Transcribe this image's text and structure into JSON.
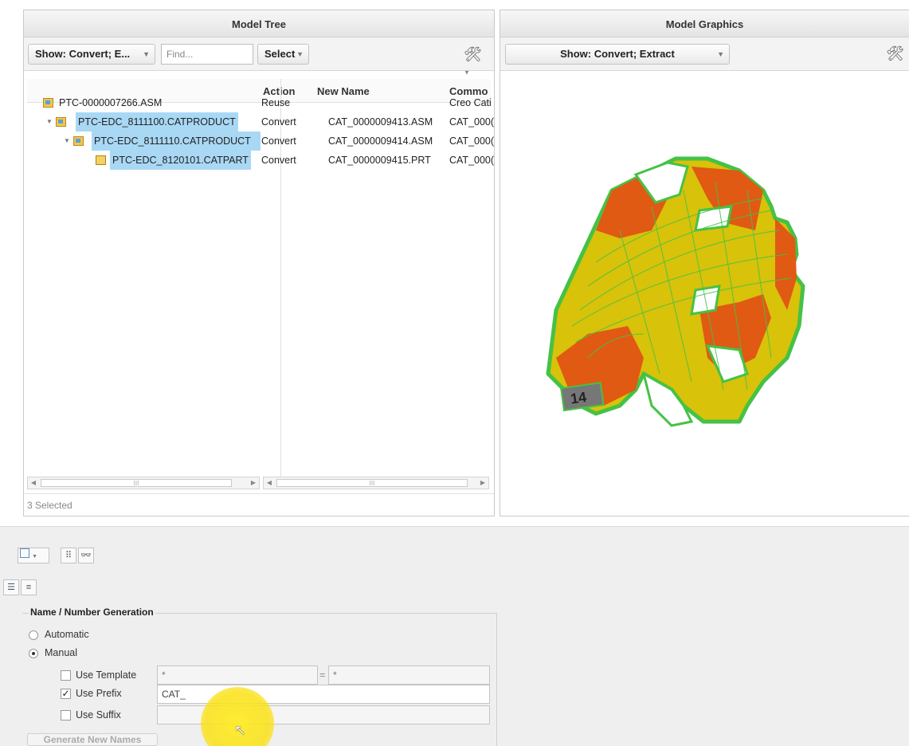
{
  "model_tree": {
    "title": "Model Tree",
    "show_filter": "Show: Convert; E...",
    "find_placeholder": "Find...",
    "select_label": "Select",
    "columns": [
      "Action",
      "New Name",
      "Commo"
    ],
    "rows": [
      {
        "name": "PTC-0000007266.ASM",
        "action": "Reuse",
        "new_name": "",
        "common": "Creo Cati"
      },
      {
        "name": "PTC-EDC_8111100.CATPRODUCT",
        "action": "Convert",
        "new_name": "CAT_0000009413.ASM",
        "common": "CAT_000("
      },
      {
        "name": "PTC-EDC_8111110.CATPRODUCT",
        "action": "Convert",
        "new_name": "CAT_0000009414.ASM",
        "common": "CAT_000("
      },
      {
        "name": "PTC-EDC_8120101.CATPART",
        "action": "Convert",
        "new_name": "CAT_0000009415.PRT",
        "common": "CAT_000("
      }
    ],
    "scroll_thumb": "III",
    "status": "3 Selected"
  },
  "model_graphics": {
    "title": "Model Graphics",
    "show_filter": "Show: Convert; Extract",
    "model_label": "14"
  },
  "naming": {
    "title": "Name / Number Generation",
    "automatic_label": "Automatic",
    "manual_label": "Manual",
    "selected_mode": "Manual",
    "use_template_label": "Use Template",
    "use_template_checked": false,
    "template_value": "*",
    "template_equals": "=",
    "template_result": "*",
    "use_prefix_label": "Use Prefix",
    "use_prefix_checked": true,
    "prefix_value": "CAT_",
    "use_suffix_label": "Use Suffix",
    "use_suffix_checked": false,
    "suffix_value": "",
    "generate_label": "Generate New Names"
  },
  "colors": {
    "selection": "#a9d8f5",
    "cursor_highlight": "#f8e11c",
    "model_orange": "#e05a14",
    "model_yellow": "#d8c20a",
    "model_edges": "#45c245"
  }
}
